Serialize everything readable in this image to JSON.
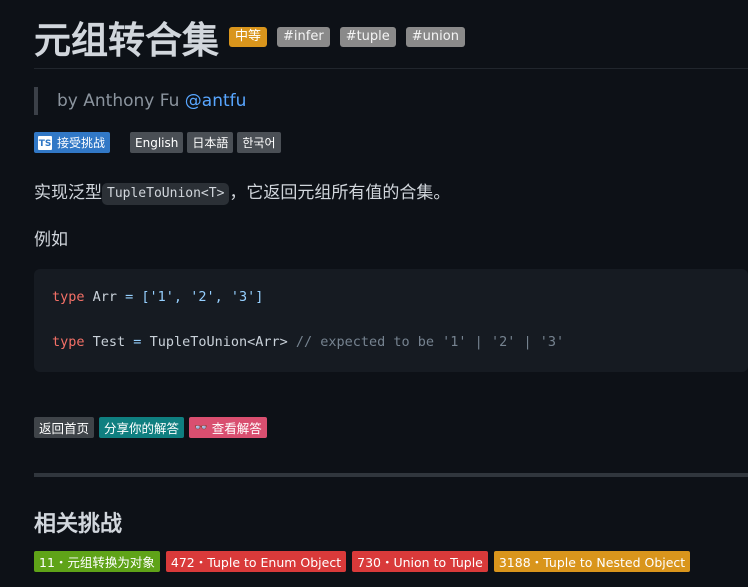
{
  "header": {
    "title": "元组转合集",
    "difficulty": "中等",
    "tags": [
      "#infer",
      "#tuple",
      "#union"
    ]
  },
  "author": {
    "prefix": "by Anthony Fu",
    "handle": "@antfu"
  },
  "badges": {
    "accept_label": "接受挑战",
    "ts_icon": "TS",
    "languages": [
      "English",
      "日本語",
      "한국어"
    ]
  },
  "description": {
    "before": "实现泛型",
    "code": "TupleToUnion<T>",
    "after": "，它返回元组所有值的合集。"
  },
  "example_label": "例如",
  "code": {
    "line1": {
      "kw": "type",
      "name": " Arr ",
      "op": "=",
      "rest": " ['1', '2', '3']"
    },
    "line2": {
      "kw": "type",
      "name": " Test ",
      "op": "=",
      "call": " TupleToUnion<Arr> ",
      "comment": "// expected to be '1' | '2' | '3'"
    }
  },
  "actions": {
    "home": "返回首页",
    "share": "分享你的解答",
    "view": "查看解答"
  },
  "related": {
    "title": "相关挑战",
    "items": [
      {
        "label": "11・元组转换为对象",
        "level": "easy",
        "color": "#5fa318"
      },
      {
        "label": "472・Tuple to Enum Object",
        "level": "hard",
        "color": "#d93a3a"
      },
      {
        "label": "730・Union to Tuple",
        "level": "hard",
        "color": "#d93a3a"
      },
      {
        "label": "3188・Tuple to Nested Object",
        "level": "medium",
        "color": "#d9951c"
      }
    ]
  },
  "colors": {
    "background": "#0d1117",
    "medium": "#d9951c",
    "link": "#58a6ff",
    "keyword": "#f47067",
    "string": "#96d0ff"
  }
}
